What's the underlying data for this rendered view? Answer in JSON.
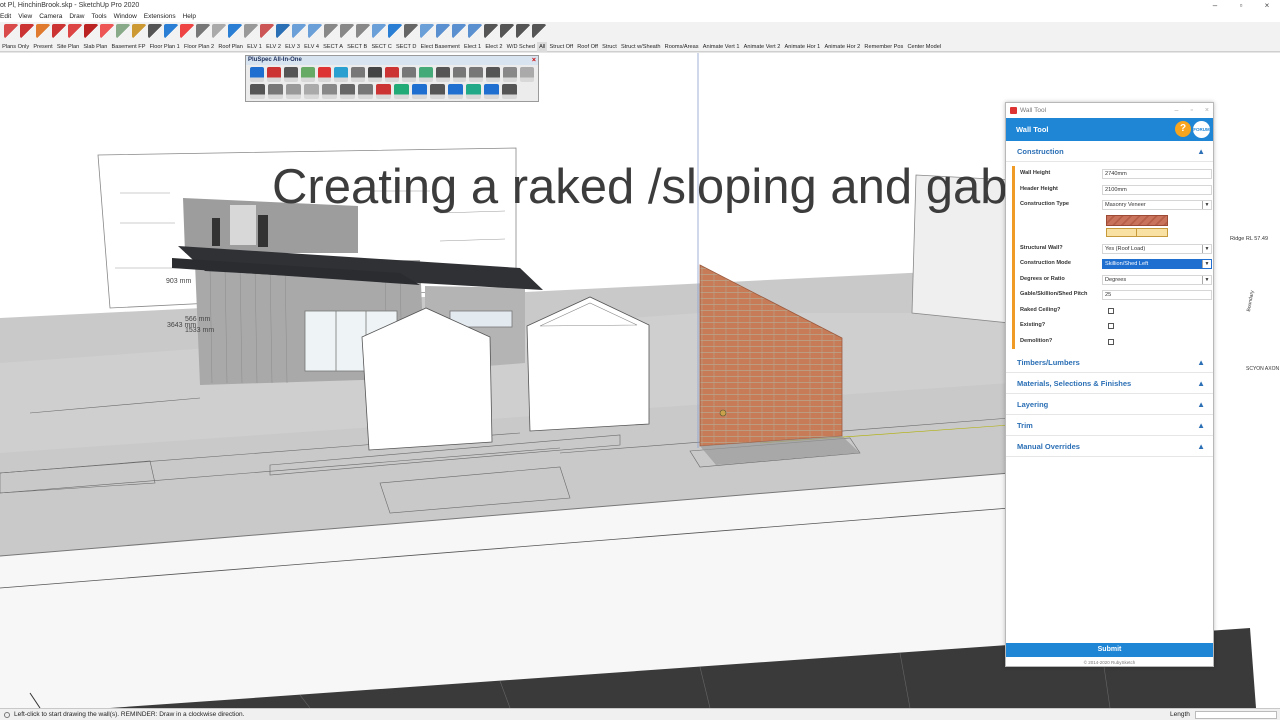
{
  "app": {
    "title": "ot Pl, HinchinBrook.skp - SketchUp Pro 2020",
    "window_controls": [
      "–",
      "▫",
      "×"
    ]
  },
  "menu": [
    "Edit",
    "View",
    "Camera",
    "Draw",
    "Tools",
    "Window",
    "Extensions",
    "Help"
  ],
  "scene_tabs": [
    "Plans Only",
    "Present",
    "Site Plan",
    "Slab Plan",
    "Basement FP",
    "Floor Plan 1",
    "Floor Plan 2",
    "Roof Plan",
    "ELV 1",
    "ELV 2",
    "ELV 3",
    "ELV 4",
    "SECT A",
    "SECT B",
    "SECT C",
    "SECT D",
    "Elect Basement",
    "Elect 1",
    "Elect 2",
    "W/D Sched",
    "All",
    "Struct Off",
    "Roof Off",
    "Struct",
    "Struct w/Sheath",
    "Rooms/Areas",
    "Animate Vert 1",
    "Animate Vert 2",
    "Animate Hor 1",
    "Animate Hor 2",
    "Remember Pos",
    "Center Model"
  ],
  "active_scene": "All",
  "overlay_title": "Creating a raked /sloping and gab",
  "pluspec": {
    "title": "PluSpec All-In-One",
    "close": "×"
  },
  "model_labels": {
    "dim_1": "903 mm",
    "dim_2": "3643 mm",
    "dim_3": "566 mm",
    "dim_4": "1533 mm",
    "right_label_1": "Ridge RL 57.49",
    "right_label_2": "Boundary",
    "right_label_3": "SCYON AXON"
  },
  "wall_tool": {
    "window_title": "Wall Tool",
    "header": "Wall Tool",
    "help_label": "?",
    "forum_label": "FORUM",
    "sections": {
      "construction": "Construction",
      "timbers": "Timbers/Lumbers",
      "materials": "Materials, Selections & Finishes",
      "layering": "Layering",
      "trim": "Trim",
      "overrides": "Manual Overrides"
    },
    "fields": {
      "wall_height_label": "Wall Height",
      "wall_height_value": "2740mm",
      "header_height_label": "Header Height",
      "header_height_value": "2100mm",
      "construction_type_label": "Construction Type",
      "construction_type_value": "Masonry Veneer",
      "structural_wall_label": "Structural Wall?",
      "structural_wall_value": "Yes (Roof Load)",
      "construction_mode_label": "Construction Mode",
      "construction_mode_value": "Skillion/Shed Left",
      "degrees_label": "Degrees or Ratio",
      "degrees_value": "Degrees",
      "pitch_label": "Gable/Skillion/Shed Pitch",
      "pitch_value": "25",
      "raked_label": "Raked Ceiling?",
      "existing_label": "Existing?",
      "demolition_label": "Demolition?"
    },
    "submit": "Submit",
    "copyright": "© 2014-2020 RubySketch"
  },
  "status": {
    "hint": "Left-click to start drawing the wall(s). REMINDER: Draw in a clockwise direction.",
    "length_label": "Length"
  },
  "colors": {
    "accent_blue": "#1f86d6",
    "field_marker": "#f19b27",
    "brick": "#c77b57"
  }
}
